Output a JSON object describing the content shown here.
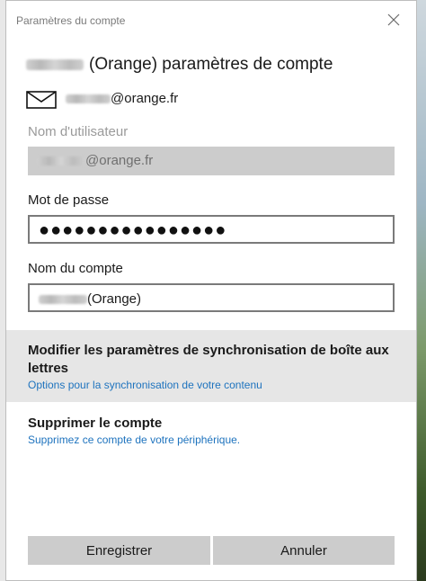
{
  "dialog": {
    "title": "Paramètres du compte",
    "heading_suffix": "(Orange) paramètres de compte",
    "email_domain": "@orange.fr"
  },
  "fields": {
    "username_label": "Nom d'utilisateur",
    "username_value_domain": "@orange.fr",
    "password_label": "Mot de passe",
    "password_value": "●●●●●●●●●●●●●●●●",
    "account_name_label": "Nom du compte",
    "account_name_suffix": "(Orange)"
  },
  "sync": {
    "title": "Modifier les paramètres de synchronisation de boîte aux lettres",
    "subtitle": "Options pour la synchronisation de votre contenu"
  },
  "delete": {
    "title": "Supprimer le compte",
    "subtitle": "Supprimez ce compte de votre périphérique."
  },
  "buttons": {
    "save": "Enregistrer",
    "cancel": "Annuler"
  },
  "icons": {
    "close": "close-icon",
    "mail": "mail-icon"
  },
  "colors": {
    "accent_link": "#1e73be",
    "button_bg": "#cccccc",
    "highlight_bg": "#e6e6e6"
  }
}
